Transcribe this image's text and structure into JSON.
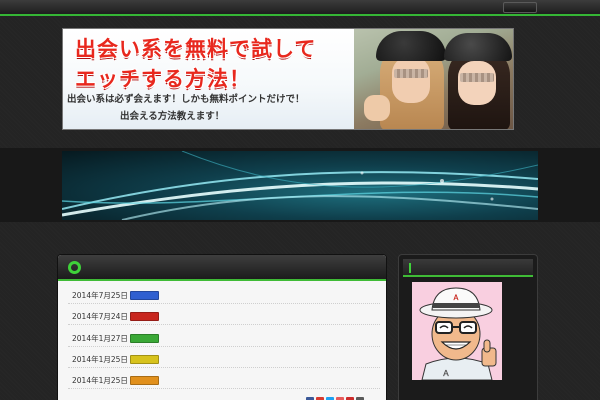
{
  "top_bar": {
    "button_label": ""
  },
  "header_banner": {
    "title_line1": "出会い系を無料で試して",
    "title_line2": "エッチする方法！",
    "subtitle_line1": "出会い系は必ず会えます！しかも無料ポイントだけで！",
    "subtitle_line2": "出会える方法教えます！"
  },
  "tagline": "",
  "news": {
    "title": "",
    "items": [
      {
        "date": "2014年7月25日",
        "tag": "",
        "tag_color": "#2f5fd0",
        "text": ""
      },
      {
        "date": "2014年7月24日",
        "tag": "",
        "tag_color": "#c8261e",
        "text": ""
      },
      {
        "date": "2014年1月27日",
        "tag": "",
        "tag_color": "#3aa836",
        "text": ""
      },
      {
        "date": "2014年1月25日",
        "tag": "",
        "tag_color": "#d7c21c",
        "text": ""
      },
      {
        "date": "2014年1月25日",
        "tag": "",
        "tag_color": "#e1901c",
        "text": ""
      }
    ],
    "share_icon_colors": [
      "#3b5998",
      "#d83a2f",
      "#1da1f2",
      "#e85b5b",
      "#cc2c2c",
      "#5a5a5a"
    ]
  },
  "profile": {
    "title": "",
    "name": "",
    "description": "",
    "cap_letter": "Ａ"
  },
  "colors": {
    "accent": "#3fbb36",
    "banner_title": "#e8281e",
    "panel_dark": "#1c1c1c"
  }
}
